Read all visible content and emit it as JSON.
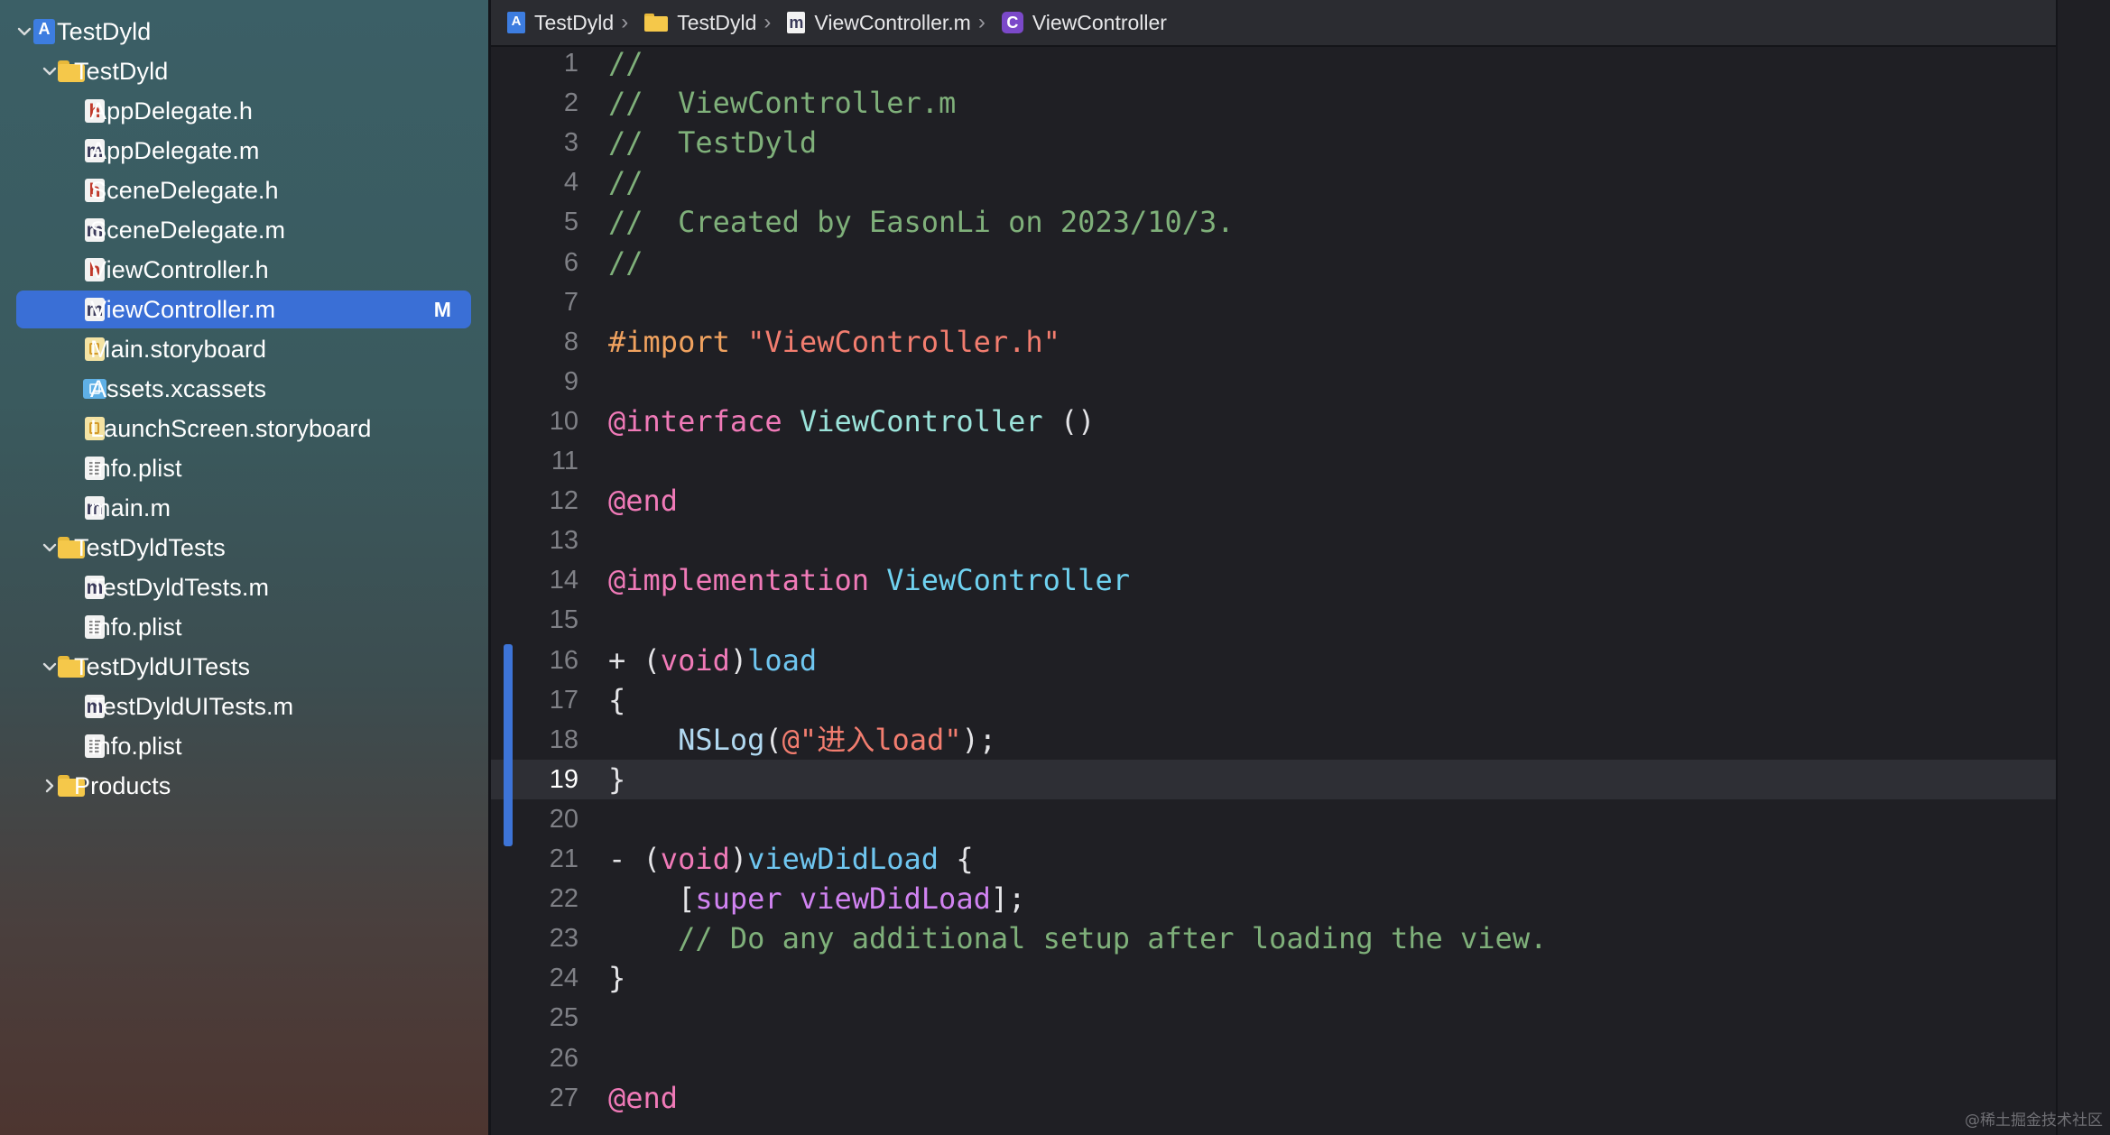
{
  "navigator": {
    "items": [
      {
        "label": "TestDyld",
        "kind": "project",
        "level": 0,
        "chevron": "down",
        "selected": false,
        "badge": ""
      },
      {
        "label": "TestDyld",
        "kind": "folder",
        "level": 1,
        "chevron": "down",
        "selected": false,
        "badge": ""
      },
      {
        "label": "AppDelegate.h",
        "kind": "h",
        "level": 2,
        "chevron": "",
        "selected": false,
        "badge": ""
      },
      {
        "label": "AppDelegate.m",
        "kind": "m",
        "level": 2,
        "chevron": "",
        "selected": false,
        "badge": ""
      },
      {
        "label": "SceneDelegate.h",
        "kind": "h",
        "level": 2,
        "chevron": "",
        "selected": false,
        "badge": ""
      },
      {
        "label": "SceneDelegate.m",
        "kind": "m",
        "level": 2,
        "chevron": "",
        "selected": false,
        "badge": ""
      },
      {
        "label": "ViewController.h",
        "kind": "h",
        "level": 2,
        "chevron": "",
        "selected": false,
        "badge": ""
      },
      {
        "label": "ViewController.m",
        "kind": "m",
        "level": 2,
        "chevron": "",
        "selected": true,
        "badge": "M"
      },
      {
        "label": "Main.storyboard",
        "kind": "storyboard",
        "level": 2,
        "chevron": "",
        "selected": false,
        "badge": ""
      },
      {
        "label": "Assets.xcassets",
        "kind": "assets",
        "level": 2,
        "chevron": "",
        "selected": false,
        "badge": ""
      },
      {
        "label": "LaunchScreen.storyboard",
        "kind": "storyboard",
        "level": 2,
        "chevron": "",
        "selected": false,
        "badge": ""
      },
      {
        "label": "Info.plist",
        "kind": "plist",
        "level": 2,
        "chevron": "",
        "selected": false,
        "badge": ""
      },
      {
        "label": "main.m",
        "kind": "m",
        "level": 2,
        "chevron": "",
        "selected": false,
        "badge": ""
      },
      {
        "label": "TestDyldTests",
        "kind": "folder",
        "level": 1,
        "chevron": "down",
        "selected": false,
        "badge": ""
      },
      {
        "label": "TestDyldTests.m",
        "kind": "m",
        "level": 2,
        "chevron": "",
        "selected": false,
        "badge": ""
      },
      {
        "label": "Info.plist",
        "kind": "plist",
        "level": 2,
        "chevron": "",
        "selected": false,
        "badge": ""
      },
      {
        "label": "TestDyldUITests",
        "kind": "folder",
        "level": 1,
        "chevron": "down",
        "selected": false,
        "badge": ""
      },
      {
        "label": "TestDyldUITests.m",
        "kind": "m",
        "level": 2,
        "chevron": "",
        "selected": false,
        "badge": ""
      },
      {
        "label": "Info.plist",
        "kind": "plist",
        "level": 2,
        "chevron": "",
        "selected": false,
        "badge": ""
      },
      {
        "label": "Products",
        "kind": "folder",
        "level": 1,
        "chevron": "right",
        "selected": false,
        "badge": ""
      }
    ]
  },
  "jumpbar": {
    "crumbs": [
      {
        "label": "TestDyld",
        "icon": "project-icon"
      },
      {
        "label": "TestDyld",
        "icon": "folder-icon"
      },
      {
        "label": "ViewController.m",
        "icon": "objc-m-file-icon"
      },
      {
        "label": "ViewController",
        "icon": "class-c-icon"
      }
    ]
  },
  "editor": {
    "current_line": 19,
    "lines": [
      {
        "n": "1",
        "tokens": [
          [
            "c",
            "//"
          ]
        ]
      },
      {
        "n": "2",
        "tokens": [
          [
            "c",
            "//  ViewController.m"
          ]
        ]
      },
      {
        "n": "3",
        "tokens": [
          [
            "c",
            "//  TestDyld"
          ]
        ]
      },
      {
        "n": "4",
        "tokens": [
          [
            "c",
            "//"
          ]
        ]
      },
      {
        "n": "5",
        "tokens": [
          [
            "c",
            "//  Created by EasonLi on 2023/10/3."
          ]
        ]
      },
      {
        "n": "6",
        "tokens": [
          [
            "c",
            "//"
          ]
        ]
      },
      {
        "n": "7",
        "tokens": []
      },
      {
        "n": "8",
        "tokens": [
          [
            "pp",
            "#import "
          ],
          [
            "s",
            "\"ViewController.h\""
          ]
        ]
      },
      {
        "n": "9",
        "tokens": []
      },
      {
        "n": "10",
        "tokens": [
          [
            "k",
            "@interface"
          ],
          [
            "p",
            " "
          ],
          [
            "t",
            "ViewController"
          ],
          [
            "p",
            " ()"
          ]
        ]
      },
      {
        "n": "11",
        "tokens": []
      },
      {
        "n": "12",
        "tokens": [
          [
            "k",
            "@end"
          ]
        ]
      },
      {
        "n": "13",
        "tokens": []
      },
      {
        "n": "14",
        "tokens": [
          [
            "k",
            "@implementation"
          ],
          [
            "p",
            " "
          ],
          [
            "t2",
            "ViewController"
          ]
        ]
      },
      {
        "n": "15",
        "tokens": []
      },
      {
        "n": "16",
        "tokens": [
          [
            "p",
            "+ ("
          ],
          [
            "k",
            "void"
          ],
          [
            "p",
            ")"
          ],
          [
            "m",
            "load"
          ]
        ]
      },
      {
        "n": "17",
        "tokens": [
          [
            "p",
            "{"
          ]
        ]
      },
      {
        "n": "18",
        "tokens": [
          [
            "p",
            "    "
          ],
          [
            "f",
            "NSLog"
          ],
          [
            "p",
            "("
          ],
          [
            "s",
            "@\"进入load\""
          ],
          [
            "p",
            ");"
          ]
        ]
      },
      {
        "n": "19",
        "tokens": [
          [
            "p",
            "}"
          ]
        ]
      },
      {
        "n": "20",
        "tokens": []
      },
      {
        "n": "21",
        "tokens": [
          [
            "p",
            "- ("
          ],
          [
            "k",
            "void"
          ],
          [
            "p",
            ")"
          ],
          [
            "m",
            "viewDidLoad"
          ],
          [
            "p",
            " {"
          ]
        ]
      },
      {
        "n": "22",
        "tokens": [
          [
            "p",
            "    ["
          ],
          [
            "su",
            "super"
          ],
          [
            "p",
            " "
          ],
          [
            "su",
            "viewDidLoad"
          ],
          [
            "p",
            "];"
          ]
        ]
      },
      {
        "n": "23",
        "tokens": [
          [
            "p",
            "    "
          ],
          [
            "c",
            "// Do any additional setup after loading the view."
          ]
        ]
      },
      {
        "n": "24",
        "tokens": [
          [
            "p",
            "}"
          ]
        ]
      },
      {
        "n": "25",
        "tokens": []
      },
      {
        "n": "26",
        "tokens": []
      },
      {
        "n": "27",
        "tokens": [
          [
            "k",
            "@end"
          ]
        ]
      }
    ]
  },
  "watermark": "@稀土掘金技术社区",
  "colors": {
    "selection": "#3a6fd6",
    "comment": "#7fb07a",
    "keyword": "#f07ab8",
    "string": "#f27d6f",
    "preprocessor": "#f0a25f",
    "change_bar": "#3d74d8"
  }
}
